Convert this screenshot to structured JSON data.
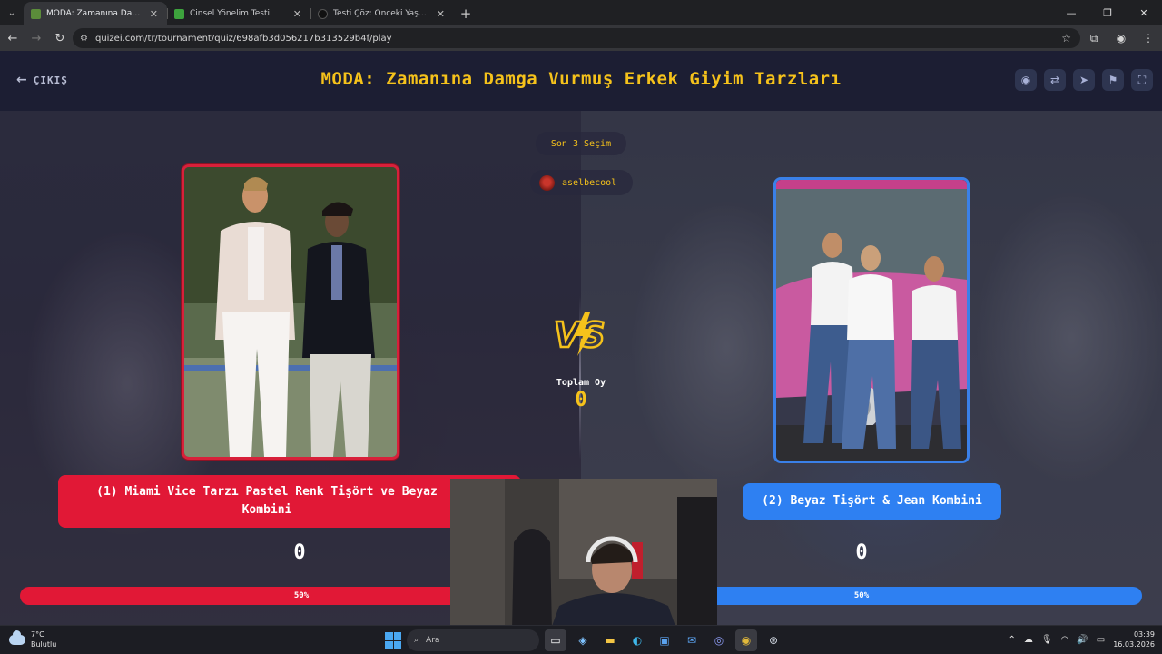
{
  "browser": {
    "tabs": [
      {
        "title": "MODA: Zamanına Damga Vurm",
        "active": true,
        "favicon_color": "#5b8c3a"
      },
      {
        "title": "Cinsel Yönelim Testi",
        "active": false,
        "favicon_color": "#3da33d"
      },
      {
        "title": "Testi Çöz: Önceki Yaşamındaki C",
        "active": false,
        "favicon_color": "#111111"
      }
    ],
    "url": "quizei.com/tr/tournament/quiz/698afb3d056217b313529b4f/play"
  },
  "page": {
    "exit_label": "ÇIKIŞ",
    "title": "MODA: Zamanına Damga Vurmuş Erkek Giyim Tarzları",
    "header_actions": [
      "eye-icon",
      "share-icon",
      "send-icon",
      "flag-icon",
      "fullscreen-icon"
    ],
    "recent_label": "Son 3 Seçim",
    "recent_user": "aselbecool",
    "vs_text": "VS",
    "total_label": "Toplam Oy",
    "total_value": "0",
    "left": {
      "label": "(1) Miami Vice Tarzı Pastel Renk Tişört ve Beyaz Kombini",
      "score": "0",
      "percent_text": "50%",
      "percent": 50,
      "color": "#e11836"
    },
    "right": {
      "label": "(2) Beyaz Tişört & Jean Kombini",
      "score": "0",
      "percent_text": "50%",
      "percent": 50,
      "color": "#2e80f2"
    },
    "accent": "#f5c21b"
  },
  "taskbar": {
    "weather_temp": "7°C",
    "weather_desc": "Bulutlu",
    "search_placeholder": "Ara",
    "time": "03:39",
    "date": "16.03.2026"
  }
}
